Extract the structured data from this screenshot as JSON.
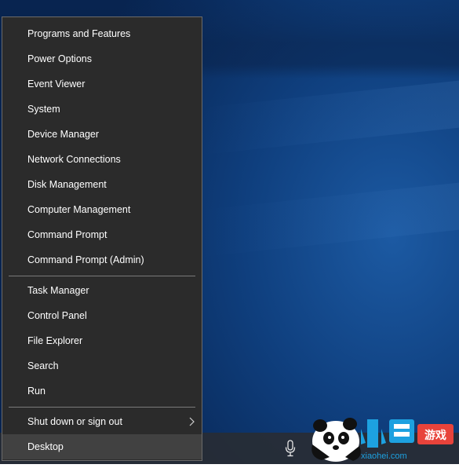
{
  "menu": {
    "items_group1": [
      "Programs and Features",
      "Power Options",
      "Event Viewer",
      "System",
      "Device Manager",
      "Network Connections",
      "Disk Management",
      "Computer Management",
      "Command Prompt",
      "Command Prompt (Admin)"
    ],
    "items_group2": [
      "Task Manager",
      "Control Panel",
      "File Explorer",
      "Search",
      "Run"
    ],
    "shutdown": "Shut down or sign out",
    "desktop": "Desktop"
  },
  "watermark": {
    "text": "小黑游戏",
    "url": "xiaohei.com"
  },
  "colors": {
    "menu_bg": "#2b2b2b",
    "menu_border": "#6b6b6b",
    "highlight": "#414141",
    "desktop_blue": "#0f3f7e"
  },
  "icons": {
    "microphone": "microphone-icon",
    "submenu": "chevron-right-icon"
  }
}
